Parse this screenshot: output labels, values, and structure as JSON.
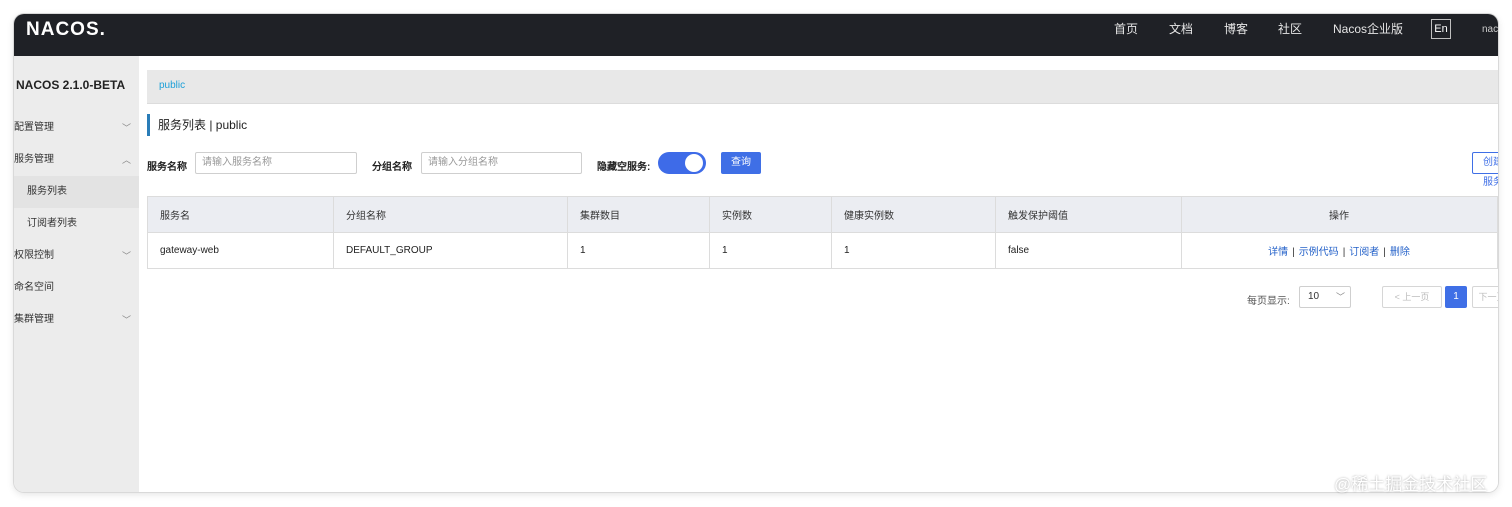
{
  "header": {
    "logo": "NACOS.",
    "nav": [
      "首页",
      "文档",
      "博客",
      "社区",
      "Nacos企业版"
    ],
    "lang": "En",
    "user": "nacos"
  },
  "sidebar": {
    "version": "NACOS 2.1.0-BETA",
    "items": [
      {
        "label": "配置管理",
        "expanded": false
      },
      {
        "label": "服务管理",
        "expanded": true
      },
      {
        "label": "服务列表",
        "sub": true,
        "active": true
      },
      {
        "label": "订阅者列表",
        "sub": true
      },
      {
        "label": "权限控制",
        "expanded": false
      },
      {
        "label": "命名空间"
      },
      {
        "label": "集群管理",
        "expanded": false
      }
    ]
  },
  "namespace_tab": "public",
  "page_title": "服务列表  |  public",
  "filters": {
    "service_name_label": "服务名称",
    "service_name_placeholder": "请输入服务名称",
    "group_name_label": "分组名称",
    "group_name_placeholder": "请输入分组名称",
    "hide_empty_label": "隐藏空服务:",
    "hide_empty_on": true,
    "search_button": "查询",
    "create_button": "创建服务"
  },
  "table": {
    "columns": [
      "服务名",
      "分组名称",
      "集群数目",
      "实例数",
      "健康实例数",
      "触发保护阈值",
      "操作"
    ],
    "rows": [
      {
        "service": "gateway-web",
        "group": "DEFAULT_GROUP",
        "clusters": "1",
        "instances": "1",
        "healthy": "1",
        "threshold": "false"
      }
    ],
    "ops": [
      "详情",
      "示例代码",
      "订阅者",
      "删除"
    ]
  },
  "pagination": {
    "per_page_label": "每页显示:",
    "per_page": "10",
    "prev": "< 上一页",
    "current": "1",
    "next": "下一页"
  },
  "watermark": "@稀土掘金技术社区",
  "colors": {
    "accent": "#3f6fe6",
    "topbar": "#1f2126",
    "link": "#2562c9"
  }
}
